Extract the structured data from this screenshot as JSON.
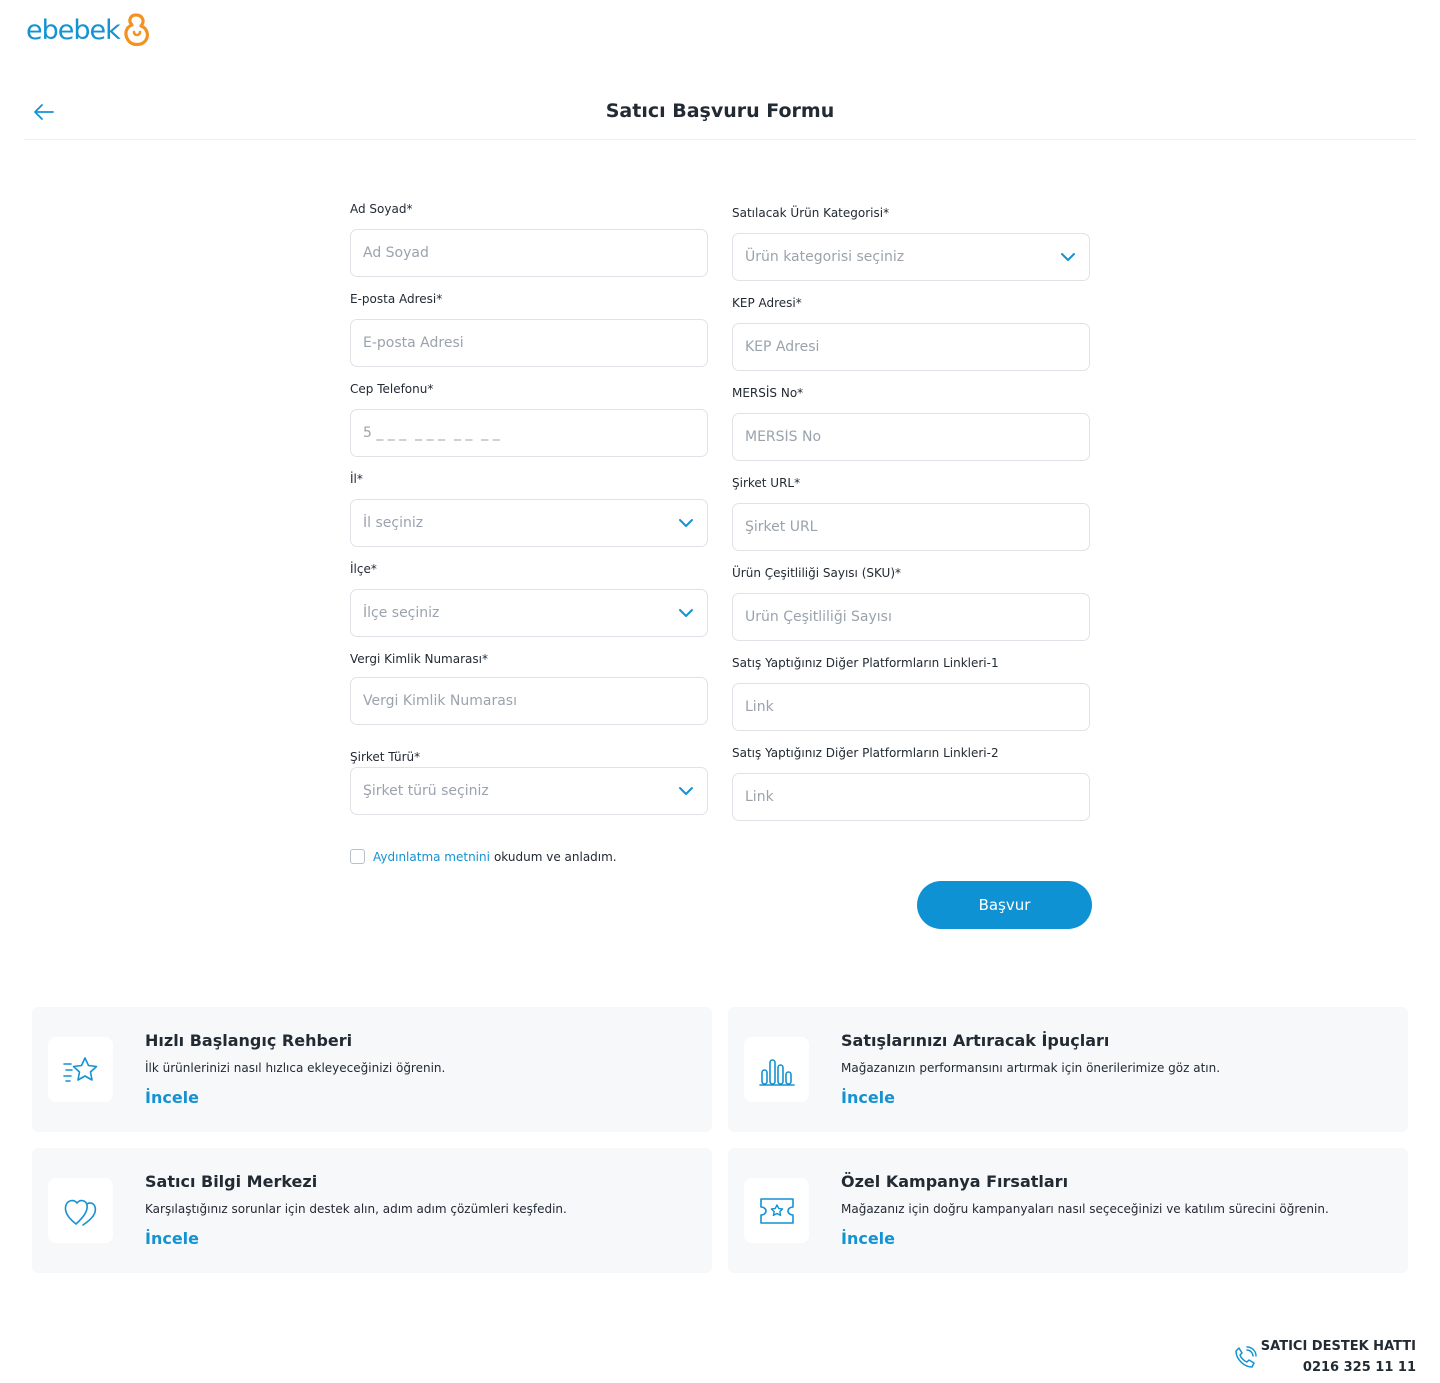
{
  "brand": {
    "name": "ebebek",
    "accent": "#1492d2",
    "orange": "#f39221"
  },
  "header": {
    "title": "Satıcı Başvuru Formu",
    "back_icon": "arrow-left-icon"
  },
  "form": {
    "left": {
      "full_name": {
        "label": "Ad Soyad*",
        "placeholder": "Ad Soyad"
      },
      "email": {
        "label": "E-posta Adresi*",
        "placeholder": "E-posta Adresi"
      },
      "phone": {
        "label": "Cep Telefonu*",
        "placeholder": "5 _ _ _  _ _ _  _ _  _ _"
      },
      "city": {
        "label": "İl*",
        "placeholder": "İl seçiniz"
      },
      "district": {
        "label": "İlçe*",
        "placeholder": "İlçe seçiniz"
      },
      "tax_id": {
        "label": "Vergi Kimlik Numarası*",
        "placeholder": "Vergi Kimlik Numarası"
      },
      "company_type": {
        "label": "Şirket Türü*",
        "placeholder": "Şirket türü seçiniz"
      }
    },
    "right": {
      "category": {
        "label": "Satılacak Ürün Kategorisi*",
        "placeholder": "Ürün kategorisi seçiniz"
      },
      "kep": {
        "label": "KEP Adresi*",
        "placeholder": "KEP Adresi"
      },
      "mersis": {
        "label": "MERSİS No*",
        "placeholder": "MERSİS No"
      },
      "company_url": {
        "label": "Şirket URL*",
        "placeholder": "Şirket URL"
      },
      "sku": {
        "label": "Ürün Çeşitliliği Sayısı (SKU)*",
        "placeholder": "Ürün Çeşitliliği Sayısı"
      },
      "link1": {
        "label": "Satış Yaptığınız Diğer Platformların Linkleri-1",
        "placeholder": "Link"
      },
      "link2": {
        "label": "Satış Yaptığınız Diğer Platformların Linkleri-2",
        "placeholder": "Link"
      }
    },
    "consent": {
      "link_text": "Aydınlatma metnini",
      "rest_text": "okudum ve anladım."
    },
    "submit_label": "Başvur"
  },
  "cards": [
    {
      "title": "Hızlı Başlangıç Rehberi",
      "desc": "İlk ürünlerinizi nasıl hızlıca ekleyeceğinizi öğrenin.",
      "link": "İncele",
      "icon": "star-speed-icon"
    },
    {
      "title": "Satışlarınızı Artıracak İpuçları",
      "desc": "Mağazanızın performansını artırmak için önerilerimize göz atın.",
      "link": "İncele",
      "icon": "bar-chart-icon"
    },
    {
      "title": "Satıcı Bilgi Merkezi",
      "desc": "Karşılaştığınız sorunlar için destek alın, adım adım çözümleri keşfedin.",
      "link": "İncele",
      "icon": "hearts-icon"
    },
    {
      "title": "Özel Kampanya Fırsatları",
      "desc": "Mağazanız için doğru kampanyaları nasıl seçeceğinizi ve katılım sürecini öğrenin.",
      "link": "İncele",
      "icon": "ticket-icon"
    }
  ],
  "support": {
    "title": "SATICI DESTEK HATTI",
    "phone": "0216 325 11 11",
    "icon": "phone-icon"
  }
}
